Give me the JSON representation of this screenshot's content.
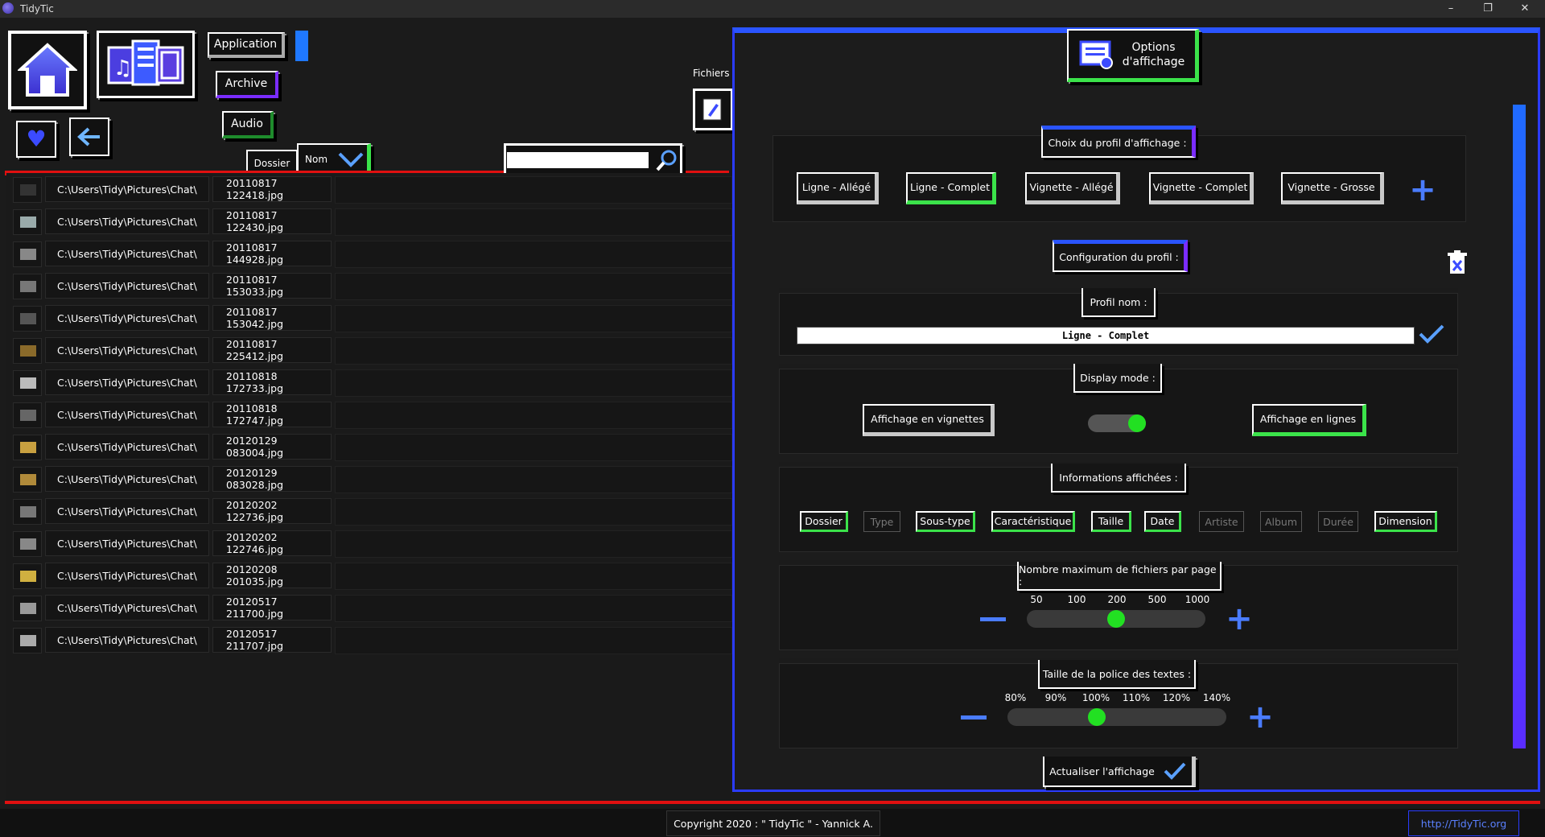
{
  "window": {
    "title": "TidyTic",
    "controls": [
      "–",
      "❐",
      "✕"
    ]
  },
  "toolbar": {
    "home_icon": "home-icon",
    "media_icon": "media-files-icon",
    "favorite_icon": "heart-icon",
    "back_icon": "arrow-left-icon",
    "categories": [
      "Application",
      "Archive",
      "Audio"
    ],
    "fichiers_label": "Fichiers",
    "sort": {
      "folder_label": "Dossier",
      "name_label": "Nom"
    },
    "search": {
      "value": "",
      "placeholder": ""
    }
  },
  "file_list": [
    {
      "path": "C:\\Users\\Tidy\\Pictures\\Chat\\",
      "name": "20110817 122418.jpg"
    },
    {
      "path": "C:\\Users\\Tidy\\Pictures\\Chat\\",
      "name": "20110817 122430.jpg"
    },
    {
      "path": "C:\\Users\\Tidy\\Pictures\\Chat\\",
      "name": "20110817 144928.jpg"
    },
    {
      "path": "C:\\Users\\Tidy\\Pictures\\Chat\\",
      "name": "20110817 153033.jpg"
    },
    {
      "path": "C:\\Users\\Tidy\\Pictures\\Chat\\",
      "name": "20110817 153042.jpg"
    },
    {
      "path": "C:\\Users\\Tidy\\Pictures\\Chat\\",
      "name": "20110817 225412.jpg"
    },
    {
      "path": "C:\\Users\\Tidy\\Pictures\\Chat\\",
      "name": "20110818 172733.jpg"
    },
    {
      "path": "C:\\Users\\Tidy\\Pictures\\Chat\\",
      "name": "20110818 172747.jpg"
    },
    {
      "path": "C:\\Users\\Tidy\\Pictures\\Chat\\",
      "name": "20120129 083004.jpg"
    },
    {
      "path": "C:\\Users\\Tidy\\Pictures\\Chat\\",
      "name": "20120129 083028.jpg"
    },
    {
      "path": "C:\\Users\\Tidy\\Pictures\\Chat\\",
      "name": "20120202 122736.jpg"
    },
    {
      "path": "C:\\Users\\Tidy\\Pictures\\Chat\\",
      "name": "20120202 122746.jpg"
    },
    {
      "path": "C:\\Users\\Tidy\\Pictures\\Chat\\",
      "name": "20120208 201035.jpg"
    },
    {
      "path": "C:\\Users\\Tidy\\Pictures\\Chat\\",
      "name": "20120517 211700.jpg"
    },
    {
      "path": "C:\\Users\\Tidy\\Pictures\\Chat\\",
      "name": "20120517 211707.jpg"
    }
  ],
  "panel": {
    "title_line1": "Options",
    "title_line2": "d'affichage",
    "profile_choice": {
      "heading": "Choix du profil d'affichage :",
      "profiles": [
        "Ligne - Allégé",
        "Ligne - Complet",
        "Vignette - Allégé",
        "Vignette - Complet",
        "Vignette - Grosse"
      ],
      "active": "Ligne - Complet"
    },
    "profile_config": {
      "heading": "Configuration du profil :",
      "name_label": "Profil nom :",
      "name_value": "Ligne - Complet"
    },
    "display_mode": {
      "heading": "Display mode :",
      "thumbnails_label": "Affichage en vignettes",
      "lines_label": "Affichage en lignes",
      "selected": "Affichage en lignes"
    },
    "info": {
      "heading": "Informations affichées :",
      "fields": [
        {
          "label": "Dossier",
          "on": true
        },
        {
          "label": "Type",
          "on": false
        },
        {
          "label": "Sous-type",
          "on": true
        },
        {
          "label": "Caractéristique",
          "on": true
        },
        {
          "label": "Taille",
          "on": true
        },
        {
          "label": "Date",
          "on": true
        },
        {
          "label": "Artiste",
          "on": false
        },
        {
          "label": "Album",
          "on": false
        },
        {
          "label": "Durée",
          "on": false
        },
        {
          "label": "Dimension",
          "on": true
        }
      ]
    },
    "max_files": {
      "heading": "Nombre maximum de fichiers par page :",
      "ticks": [
        "50",
        "100",
        "200",
        "500",
        "1000"
      ],
      "value": "200"
    },
    "font_size": {
      "heading": "Taille de la police des textes :",
      "ticks": [
        "80%",
        "90%",
        "100%",
        "110%",
        "120%",
        "140%"
      ],
      "value": "100%"
    },
    "refresh_label": "Actualiser l'affichage"
  },
  "footer": {
    "copyright": "Copyright 2020 : \" TidyTic \" - Yannick A.",
    "url": "http://TidyTic.org"
  },
  "colors": {
    "accent_blue": "#2b3cff",
    "accent_green": "#3be34a",
    "accent_red": "#e01010",
    "purple": "#7a2cff"
  }
}
